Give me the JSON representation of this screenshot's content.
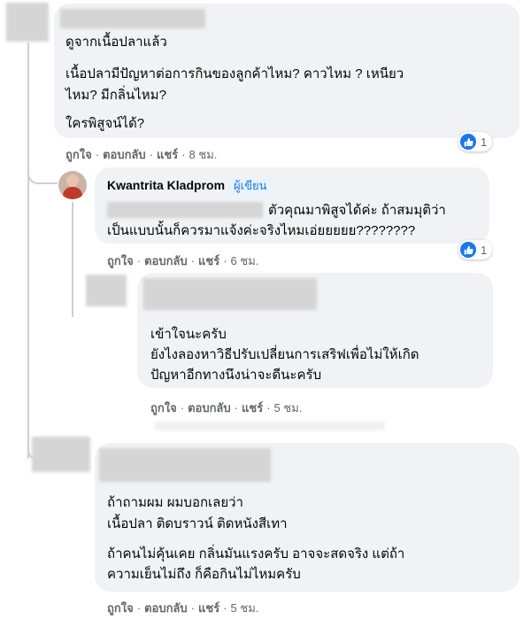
{
  "comments": [
    {
      "lines": [
        "ดูจากเนื้อปลาแล้ว",
        "เนื้อปลามีปัญหาต่อการกินของลูกค้าไหม? คาวไหม ? เหนียว",
        "ไหม? มีกลิ่นไหม?",
        "ใครพิสูจน์ได้?"
      ],
      "actions": {
        "like": "ถูกใจ",
        "reply": "ตอบกลับ",
        "share": "แชร์",
        "time": "8 ชม."
      },
      "reaction_count": "1"
    },
    {
      "author": "Kwantrita Kladprom",
      "badge": "ผู้เขียน",
      "lines": [
        "ตัวคุณมาพิสูจได้ค่ะ ถ้าสมมุติว่า",
        "เป็นแบบนั้นก็ควรมาแจ้งค่ะจริงไหมเอ่ยยยยย????????"
      ],
      "actions": {
        "like": "ถูกใจ",
        "reply": "ตอบกลับ",
        "share": "แชร์",
        "time": "6 ชม."
      },
      "reaction_count": "1"
    },
    {
      "lines": [
        "เข้าใจนะครับ",
        "ยังไงลองหาวิธีปรับเปลี่ยนการเสริฟเพื่อไม่ให้เกิด",
        "ปัญหาอีกทางนึงน่าจะดีนะครับ"
      ],
      "actions": {
        "like": "ถูกใจ",
        "reply": "ตอบกลับ",
        "share": "แชร์",
        "time": "5 ชม."
      }
    },
    {
      "lines": [
        "ถ้าถามผม ผมบอกเลยว่า",
        "เนื้อปลา ติดบราวน์ ติดหนังสีเทา",
        "ถ้าคนไม่คุ้นเคย กลิ่นมันแรงครับ อาจจะสดจริง แต่ถ้า",
        "ความเย็นไม่ถึง ก็คือกินไม่ไหมครับ"
      ],
      "actions": {
        "like": "ถูกใจ",
        "reply": "ตอบกลับ",
        "share": "แชร์",
        "time": "5 ชม."
      }
    }
  ],
  "icons": {
    "reaction": "like-thumb-icon"
  },
  "colors": {
    "bubble": "#f0f2f5",
    "meta": "#65676b",
    "accent": "#1877f2"
  }
}
